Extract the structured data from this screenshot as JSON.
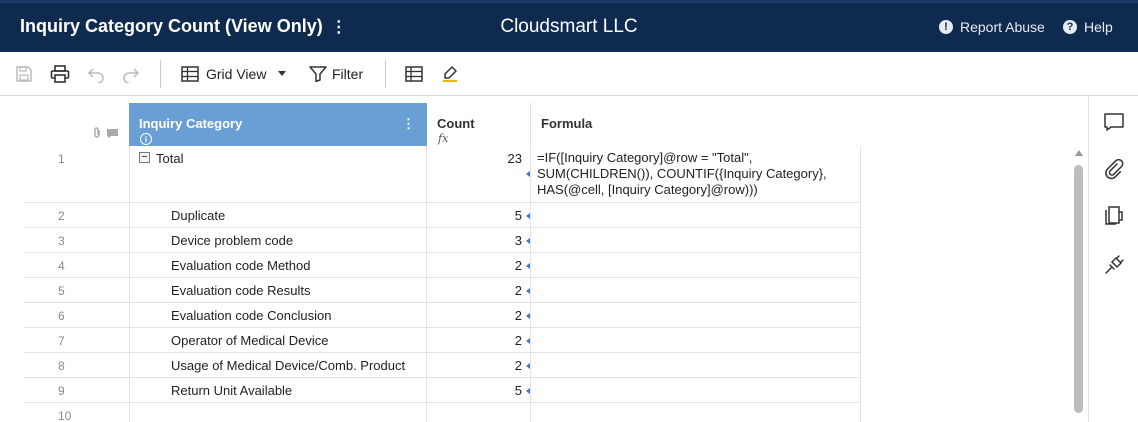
{
  "header": {
    "sheet_title": "Inquiry Category Count (View Only)",
    "title_menu_glyph": "⋮",
    "company": "Cloudsmart LLC",
    "report_abuse": "Report Abuse",
    "report_icon_glyph": "!",
    "help": "Help",
    "help_icon_glyph": "?"
  },
  "toolbar": {
    "icons": [
      "save-icon",
      "print-icon",
      "undo-icon",
      "redo-icon",
      "grid-view-icon",
      "chevron-down-icon",
      "filter-icon",
      "table-icon",
      "highlight-icon"
    ],
    "view_label": "Grid View",
    "filter_label": "Filter"
  },
  "columns": {
    "primary": "Inquiry Category",
    "primary_info_glyph": "i",
    "primary_menu_glyph": "⋮",
    "count": "Count",
    "count_fx": "fx",
    "formula": "Formula"
  },
  "rows": [
    {
      "num": "1",
      "category": "Total",
      "count": "23",
      "formula": "=IF([Inquiry Category]@row = \"Total\", SUM(CHILDREN()), COUNTIF({Inquiry Category}, HAS(@cell, [Inquiry Category]@row)))",
      "expander": "−"
    },
    {
      "num": "2",
      "category": "Duplicate",
      "count": "5"
    },
    {
      "num": "3",
      "category": "Device problem code",
      "count": "3"
    },
    {
      "num": "4",
      "category": "Evaluation code Method",
      "count": "2"
    },
    {
      "num": "5",
      "category": "Evaluation code Results",
      "count": "2"
    },
    {
      "num": "6",
      "category": "Evaluation code Conclusion",
      "count": "2"
    },
    {
      "num": "7",
      "category": "Operator of Medical Device",
      "count": "2"
    },
    {
      "num": "8",
      "category": "Usage of Medical Device/Comb. Product",
      "count": "2"
    },
    {
      "num": "9",
      "category": "Return Unit Available",
      "count": "5"
    },
    {
      "num": "10",
      "category": "",
      "count": ""
    }
  ],
  "rail_icons": [
    "comment-icon",
    "attachment-icon",
    "proofs-icon",
    "connections-icon"
  ],
  "colors": {
    "header_bg": "#0e2a4e",
    "primary_column": "#6a9fd6",
    "link_marker": "#3a78c8"
  }
}
